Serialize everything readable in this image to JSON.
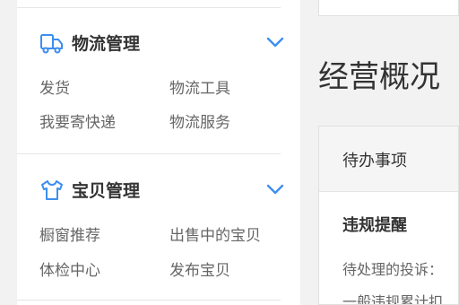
{
  "sidebar": {
    "logistics": {
      "title": "物流管理",
      "icon": "truck-icon",
      "links": [
        "发货",
        "物流工具",
        "我要寄快递",
        "物流服务"
      ]
    },
    "goods": {
      "title": "宝贝管理",
      "icon": "tshirt-icon",
      "links": [
        "橱窗推荐",
        "出售中的宝贝",
        "体检中心",
        "发布宝贝"
      ]
    }
  },
  "main": {
    "heading": "经营概况",
    "card": {
      "header": "待办事项",
      "subheading": "违规提醒",
      "lines": [
        "待处理的投诉：",
        "一般违规累计扣"
      ]
    }
  },
  "colors": {
    "icon_blue": "#3d8ef0",
    "chevron_blue": "#3d8ef0"
  }
}
